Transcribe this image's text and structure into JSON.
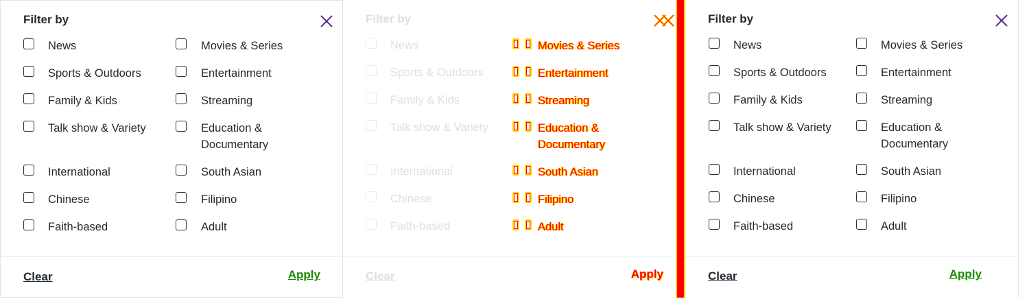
{
  "panels": [
    {
      "title": "Filter by",
      "close_icon": "close-icon",
      "filters_left": [
        "News",
        "Sports & Outdoors",
        "Family & Kids",
        "Talk show & Variety",
        "International",
        "Chinese",
        "Faith-based"
      ],
      "filters_right": [
        "Movies & Series",
        "Entertainment",
        "Streaming",
        "Education &",
        "South Asian",
        "Filipino",
        "Adult"
      ],
      "education_line2": "Documentary",
      "clear_label": "Clear",
      "apply_label": "Apply"
    }
  ],
  "colors": {
    "accent_close": "#5b2d90",
    "apply_green": "#1a8a00",
    "highlight_red": "#ff0000",
    "highlight_yellow": "#ffd400"
  }
}
